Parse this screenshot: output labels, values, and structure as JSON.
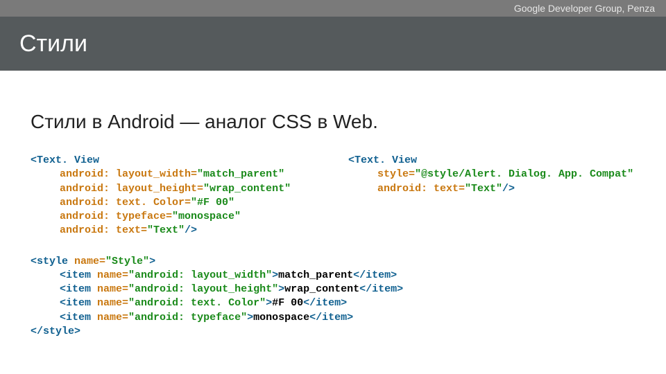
{
  "topbar": {
    "label": "Google Developer Group, Penza"
  },
  "title": "Стили",
  "subtitle": "Стили в Android — аналог CSS в Web.",
  "code_left": {
    "open_lt": "<",
    "tag": "Text. View",
    "attrs": [
      {
        "name": "android: layout_width=",
        "value": "\"match_parent\""
      },
      {
        "name": "android: layout_height=",
        "value": "\"wrap_content\""
      },
      {
        "name": "android: text. Color=",
        "value": "\"#F 00\""
      },
      {
        "name": "android: typeface=",
        "value": "\"monospace\""
      },
      {
        "name": "android: text=",
        "value": "\"Text\""
      }
    ],
    "close": "/>"
  },
  "code_right": {
    "open_lt": "<",
    "tag": "Text. View",
    "attrs": [
      {
        "name": "style=",
        "value": "\"@style/Alert. Dialog. App. Compat\""
      },
      {
        "name": "android: text=",
        "value": "\"Text\""
      }
    ],
    "close": "/>"
  },
  "code_style": {
    "open_lt": "<",
    "tag_open": "style ",
    "name_attr": "name=",
    "name_val": "\"Style\"",
    "gt": ">",
    "items": [
      {
        "open_lt": "<",
        "tag": "item ",
        "name_attr": "name=",
        "name_val": "\"android: layout_width\"",
        "gt": ">",
        "text": "match_parent",
        "close_lt": "</",
        "close_tag": "item",
        "close_gt": ">"
      },
      {
        "open_lt": "<",
        "tag": "item ",
        "name_attr": "name=",
        "name_val": "\"android: layout_height\"",
        "gt": ">",
        "text": "wrap_content",
        "close_lt": "</",
        "close_tag": "item",
        "close_gt": ">"
      },
      {
        "open_lt": "<",
        "tag": "item ",
        "name_attr": "name=",
        "name_val": "\"android: text. Color\"",
        "gt": ">",
        "text": "#F 00",
        "close_lt": "</",
        "close_tag": "item",
        "close_gt": ">"
      },
      {
        "open_lt": "<",
        "tag": "item ",
        "name_attr": "name=",
        "name_val": "\"android: typeface\"",
        "gt": ">",
        "text": "monospace",
        "close_lt": "</",
        "close_tag": "item",
        "close_gt": ">"
      }
    ],
    "close_lt": "</",
    "tag_close": "style",
    "close_gt": ">"
  }
}
